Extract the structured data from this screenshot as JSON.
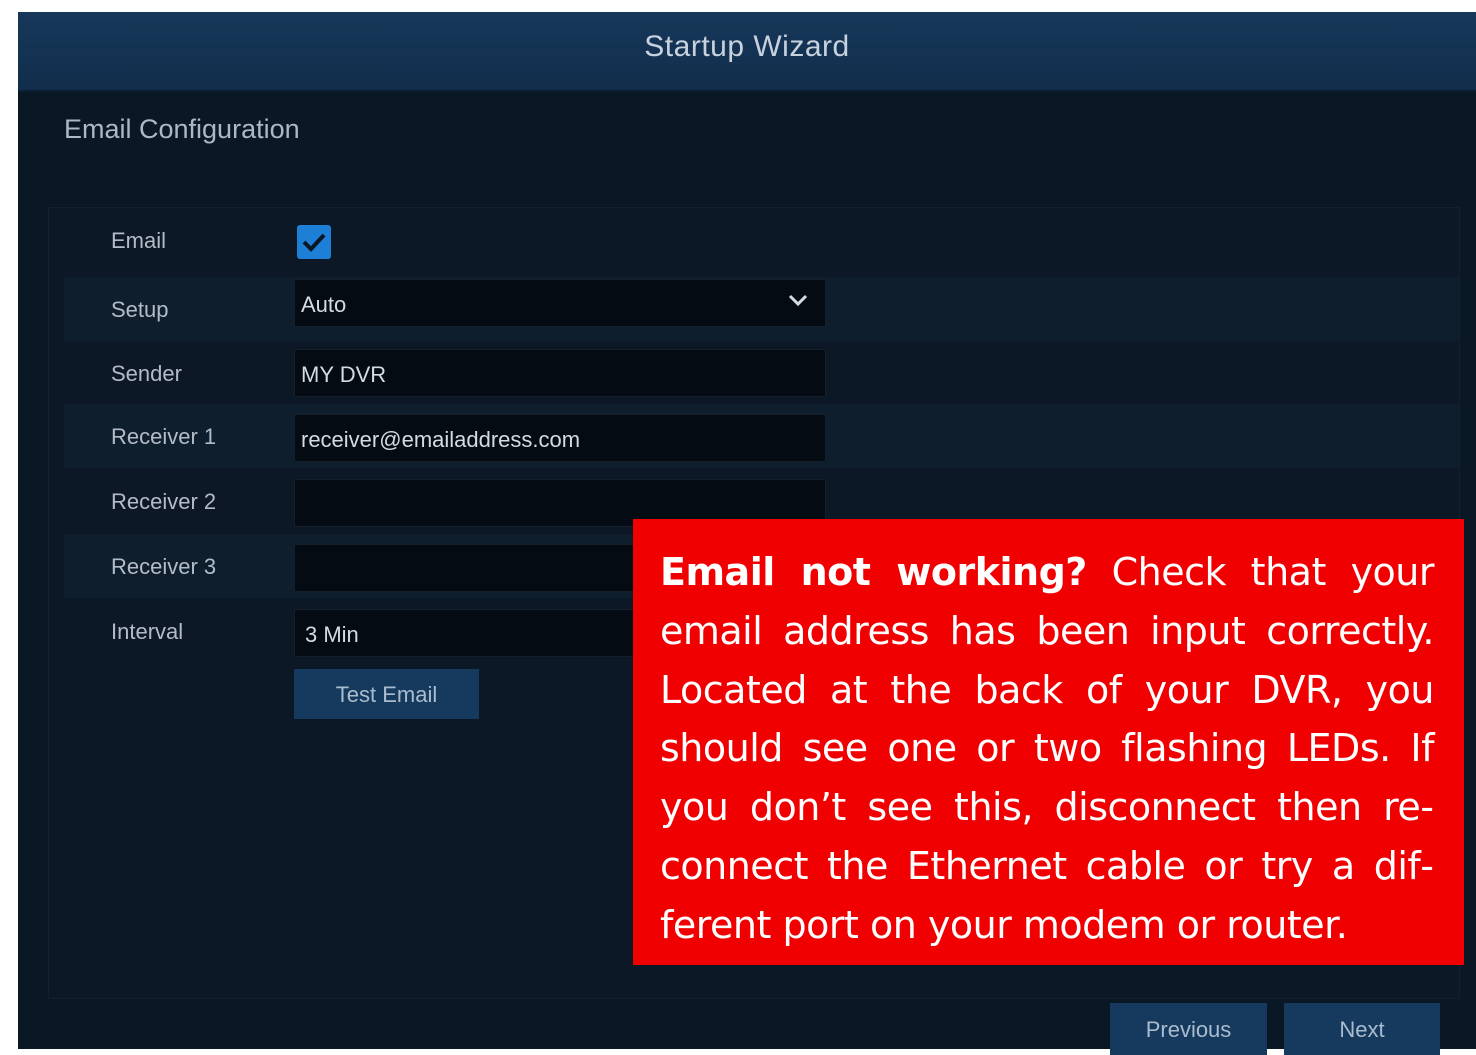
{
  "window": {
    "title": "Startup Wizard"
  },
  "section": {
    "title": "Email Configuration"
  },
  "form": {
    "email": {
      "label": "Email",
      "checked": true
    },
    "setup": {
      "label": "Setup",
      "value": "Auto"
    },
    "sender": {
      "label": "Sender",
      "value": "MY DVR"
    },
    "receiver1": {
      "label": "Receiver 1",
      "value": "receiver@emailaddress.com"
    },
    "receiver2": {
      "label": "Receiver 2",
      "value": ""
    },
    "receiver3": {
      "label": "Receiver 3",
      "value": ""
    },
    "interval": {
      "label": "Interval",
      "value": "3 Min"
    },
    "test_button": "Test Email"
  },
  "footer": {
    "previous": "Previous",
    "next": "Next"
  },
  "callout": {
    "heading": "Email not working?",
    "body": " Check that your email address has been input correct­ly. Located at the back of your DVR, you should see one or two flashing LEDs. If you don’t see this, disconnect then re­connect the Ethernet cable or try a dif­ferent port on your modem or router."
  },
  "colors": {
    "titlebar": "#112d4b",
    "background": "#0a1724",
    "accent_checkbox": "#1e7fd6",
    "callout": "#f00000"
  }
}
